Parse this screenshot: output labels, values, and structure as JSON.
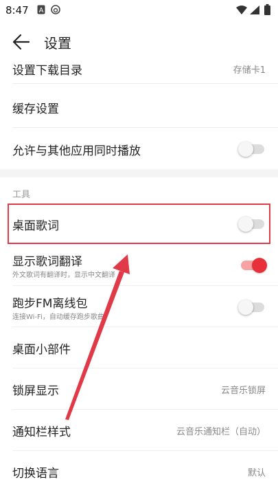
{
  "status_bar": {
    "time": "8:47",
    "icons": [
      "a-badge-icon",
      "netease-icon",
      "wifi-icon",
      "signal-icon",
      "battery-icon"
    ]
  },
  "header": {
    "title": "设置"
  },
  "items": {
    "download_dir": {
      "label": "设置下载目录",
      "value": "存储卡1"
    },
    "cache": {
      "label": "缓存设置"
    },
    "allow_other_apps": {
      "label": "允许与其他应用同时播放",
      "toggle": false
    },
    "tools_section": "工具",
    "desktop_lyrics": {
      "label": "桌面歌词",
      "toggle": false
    },
    "lyric_translation": {
      "label": "显示歌词翻译",
      "sub": "外文歌词有翻译时，显示中文翻译",
      "toggle": true
    },
    "running_fm": {
      "label": "跑步FM离线包",
      "sub": "连接Wi-Fi，自动缓存跑步歌曲",
      "toggle": false
    },
    "desktop_widget": {
      "label": "桌面小部件"
    },
    "lockscreen": {
      "label": "锁屏显示",
      "value": "云音乐锁屏"
    },
    "notification_style": {
      "label": "通知栏样式",
      "value": "云音乐通知栏（自动）"
    },
    "language": {
      "label": "切换语言",
      "value": "默认"
    }
  },
  "colors": {
    "accent": "#e8303a",
    "highlight": "#e03a48",
    "toggle_off": "#dcdcdc"
  }
}
